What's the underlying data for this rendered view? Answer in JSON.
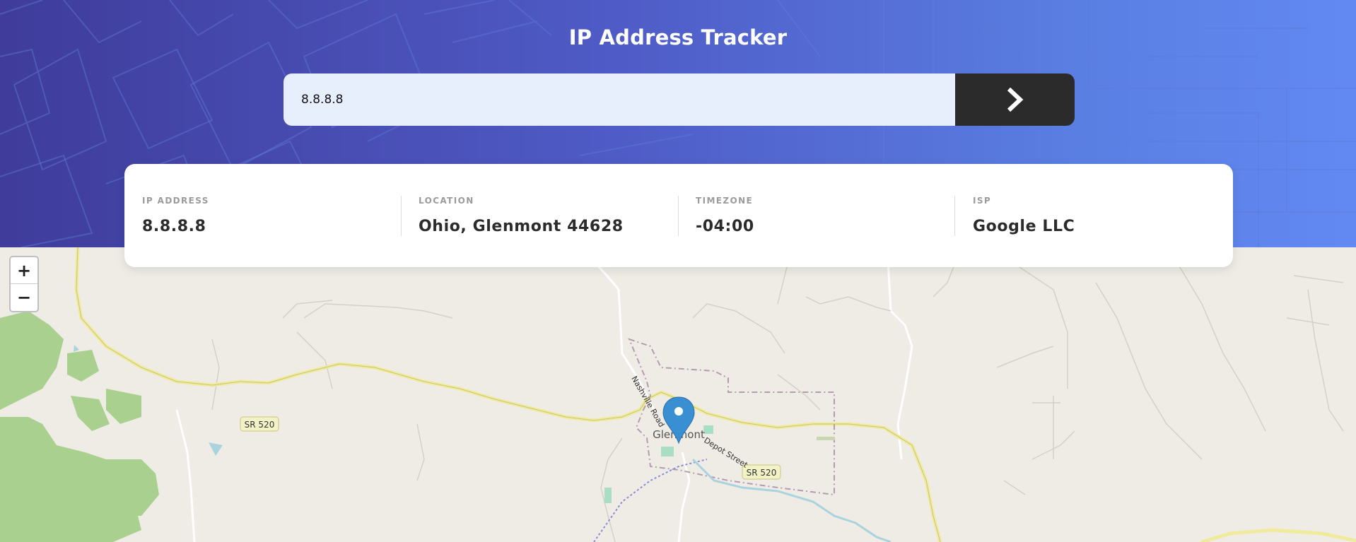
{
  "header": {
    "title": "IP Address Tracker"
  },
  "search": {
    "value": "8.8.8.8",
    "submit_icon": "chevron-right-icon"
  },
  "info": [
    {
      "label": "IP ADDRESS",
      "value": "8.8.8.8"
    },
    {
      "label": "LOCATION",
      "value": "Ohio, Glenmont 44628"
    },
    {
      "label": "TIMEZONE",
      "value": "-04:00"
    },
    {
      "label": "ISP",
      "value": "Google LLC"
    }
  ],
  "map": {
    "zoom_in": "+",
    "zoom_out": "−",
    "place_name": "Glenmont",
    "road_labels": [
      "SR 520",
      "SR 520",
      "Nashville Road",
      "Depot Street"
    ],
    "marker_icon": "location-pin-icon",
    "marker_color": "#3a8fd3"
  },
  "colors": {
    "header_gradient_start": "#3f3c9b",
    "header_gradient_end": "#6289f2",
    "button_bg": "#2b2b2b",
    "input_bg": "#e8effc"
  }
}
